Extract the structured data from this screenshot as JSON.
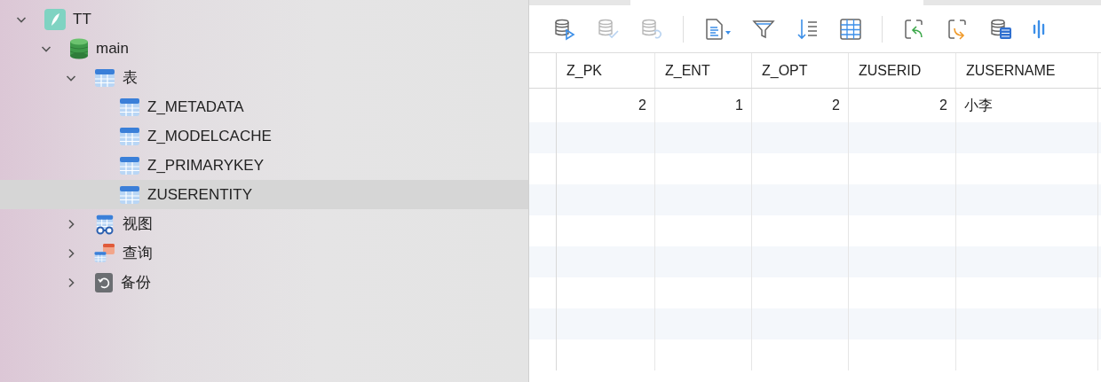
{
  "sidebar": {
    "tree": [
      {
        "label": "TT",
        "kind": "connection",
        "expanded": true,
        "selected": false,
        "children": [
          {
            "label": "main",
            "kind": "database",
            "expanded": true,
            "selected": false,
            "children": [
              {
                "label": "表",
                "kind": "tables",
                "expanded": true,
                "selected": false,
                "children": [
                  {
                    "label": "Z_METADATA",
                    "kind": "table",
                    "selected": false
                  },
                  {
                    "label": "Z_MODELCACHE",
                    "kind": "table",
                    "selected": false
                  },
                  {
                    "label": "Z_PRIMARYKEY",
                    "kind": "table",
                    "selected": false
                  },
                  {
                    "label": "ZUSERENTITY",
                    "kind": "table",
                    "selected": true
                  }
                ]
              },
              {
                "label": "视图",
                "kind": "views",
                "expanded": false,
                "selected": false
              },
              {
                "label": "查询",
                "kind": "queries",
                "expanded": false,
                "selected": false
              },
              {
                "label": "备份",
                "kind": "backups",
                "expanded": false,
                "selected": false
              }
            ]
          }
        ]
      }
    ]
  },
  "toolbar": [
    {
      "kind": "run",
      "disabled": false
    },
    {
      "kind": "commit",
      "disabled": true
    },
    {
      "kind": "revert",
      "disabled": true
    },
    {
      "kind": "separator"
    },
    {
      "kind": "document",
      "disabled": false
    },
    {
      "kind": "filter",
      "disabled": false
    },
    {
      "kind": "sort",
      "disabled": false
    },
    {
      "kind": "grid",
      "disabled": false
    },
    {
      "kind": "separator"
    },
    {
      "kind": "import",
      "disabled": false
    },
    {
      "kind": "export",
      "disabled": false
    },
    {
      "kind": "text",
      "disabled": false
    },
    {
      "kind": "chart",
      "disabled": false
    }
  ],
  "table": {
    "columns": [
      {
        "label": "Z_PK",
        "kind": "number"
      },
      {
        "label": "Z_ENT",
        "kind": "number"
      },
      {
        "label": "Z_OPT",
        "kind": "number"
      },
      {
        "label": "ZUSERID",
        "kind": "number"
      },
      {
        "label": "ZUSERNAME",
        "kind": "text"
      }
    ],
    "rows": [
      [
        "2",
        "1",
        "2",
        "2",
        "小李"
      ]
    ]
  }
}
